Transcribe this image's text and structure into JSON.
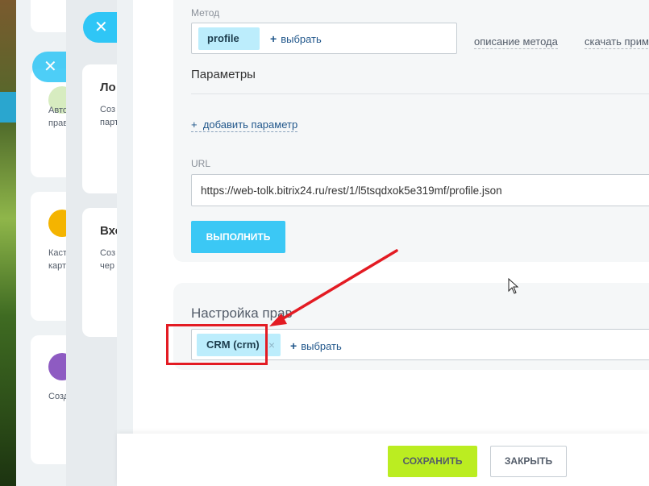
{
  "background_cards": [
    {
      "text_lines": [
        "Авто",
        "прав"
      ],
      "icon_color": "#d7ecc0"
    },
    {
      "text_lines": [
        "Каст",
        "карт"
      ],
      "icon_color": "#f4b400"
    },
    {
      "text_lines": [
        "Созд"
      ],
      "icon_color": "#8e5bc2"
    }
  ],
  "middle_cards": [
    {
      "title": "Ло",
      "desc": [
        "Соз",
        "парт"
      ]
    },
    {
      "title": "Вхо",
      "desc": [
        "Соз",
        "чер"
      ]
    }
  ],
  "close_glyph": "✕",
  "method": {
    "label": "Метод",
    "value_chip": "profile",
    "select_plus": "+",
    "select_label": "выбрать",
    "describe_link": "описание метода",
    "download_link": "скачать пример"
  },
  "params": {
    "heading": "Параметры",
    "add_plus": "+",
    "add_label": "добавить параметр"
  },
  "url": {
    "label": "URL",
    "value": "https://web-tolk.bitrix24.ru/rest/1/l5tsqdxok5e319mf/profile.json"
  },
  "run_button": "ВЫПОЛНИТЬ",
  "rights": {
    "heading": "Настройка прав",
    "chip": "CRM (crm)",
    "chip_remove": "×",
    "select_plus": "+",
    "select_label": "выбрать"
  },
  "footer": {
    "save": "СОХРАНИТЬ",
    "close": "ЗАКРЫТЬ"
  },
  "colors": {
    "accent": "#2fc6f6",
    "save_green": "#bbed21",
    "chip_blue": "#bcedfc",
    "annotation_red": "#e31b23"
  }
}
